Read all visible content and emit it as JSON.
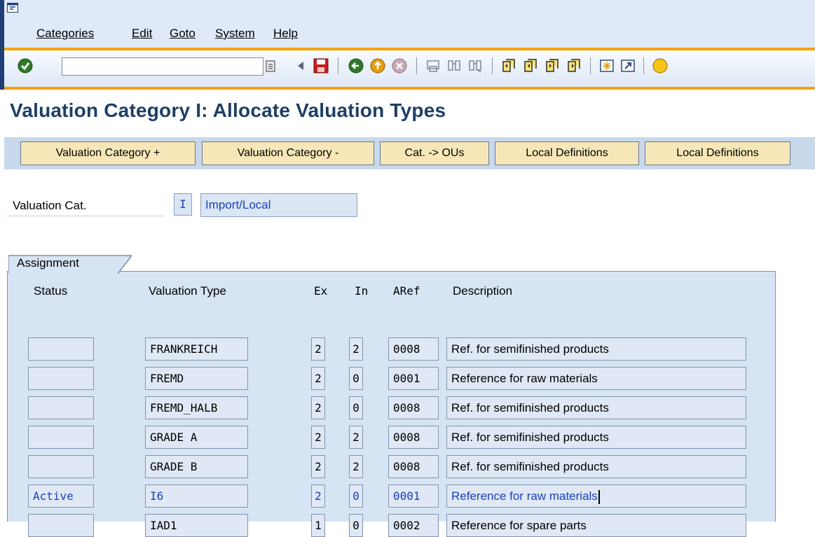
{
  "menu": {
    "items": [
      "Categories",
      "Edit",
      "Goto",
      "System",
      "Help"
    ]
  },
  "toolbar": {
    "command_field_value": "",
    "icons": [
      "enter-check-icon",
      "command-dropdown-icon",
      "left-triangle-icon",
      "save-icon",
      "back-icon",
      "exit-icon",
      "cancel-icon",
      "print-icon",
      "find-icon",
      "find-next-icon",
      "first-page-icon",
      "previous-page-icon",
      "next-page-icon",
      "last-page-icon",
      "create-session-icon",
      "create-shortcut-icon",
      "help-icon"
    ]
  },
  "page": {
    "title": "Valuation Category I: Allocate Valuation Types"
  },
  "app_buttons": [
    "Valuation Category +",
    "Valuation Category -",
    "Cat. -> OUs",
    "Local Definitions",
    "Local Definitions"
  ],
  "fields": {
    "valuation_cat_label": "Valuation Cat.",
    "valuation_cat_code": "I",
    "valuation_cat_text": "Import/Local"
  },
  "assignment": {
    "group_title": "Assignment",
    "headers": {
      "status": "Status",
      "valuation_type": "Valuation Type",
      "ex": "Ex",
      "in": "In",
      "aref": "ARef",
      "description": "Description"
    },
    "rows": [
      {
        "status": "",
        "valuation_type": "FRANKREICH",
        "ex": "2",
        "in": "2",
        "aref": "0008",
        "description": "Ref. for semifinished products"
      },
      {
        "status": "",
        "valuation_type": "FREMD",
        "ex": "2",
        "in": "0",
        "aref": "0001",
        "description": "Reference for raw materials"
      },
      {
        "status": "",
        "valuation_type": "FREMD_HALB",
        "ex": "2",
        "in": "0",
        "aref": "0008",
        "description": "Ref. for semifinished products"
      },
      {
        "status": "",
        "valuation_type": "GRADE A",
        "ex": "2",
        "in": "2",
        "aref": "0008",
        "description": "Ref. for semifinished products"
      },
      {
        "status": "",
        "valuation_type": "GRADE B",
        "ex": "2",
        "in": "2",
        "aref": "0008",
        "description": "Ref. for semifinished products"
      },
      {
        "status": "Active",
        "valuation_type": "I6",
        "ex": "2",
        "in": "0",
        "aref": "0001",
        "description": "Reference for raw materials"
      },
      {
        "status": "",
        "valuation_type": "IAD1",
        "ex": "1",
        "in": "0",
        "aref": "0002",
        "description": "Reference for spare parts"
      }
    ]
  },
  "colors": {
    "title": "#1d3f66",
    "accent_orange": "#f7a200",
    "active_text": "#1a40c0",
    "button_bg": "#f7e7b8"
  }
}
